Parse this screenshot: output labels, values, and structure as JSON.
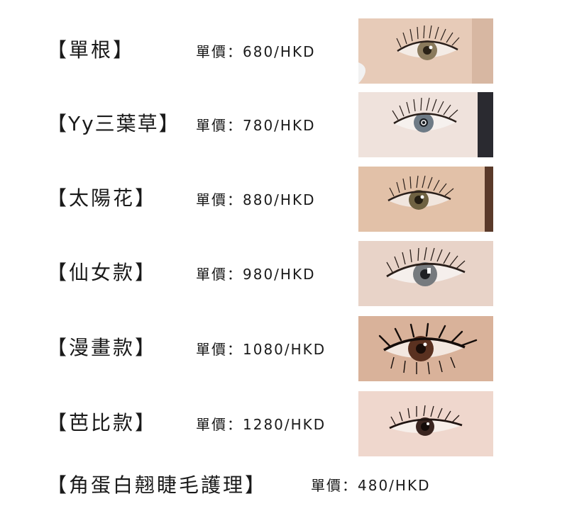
{
  "items": [
    {
      "name": "【單根】",
      "price": "單價：680/HKD",
      "photo": "eye-photo-natural-single-lash",
      "skin": "#e7cbb8",
      "iris": "#8a7a5c"
    },
    {
      "name": "【Yy三葉草】",
      "price": "單價：780/HKD",
      "photo": "eye-photo-clover-lash",
      "skin": "#efe2dc",
      "iris": "#6e7b86"
    },
    {
      "name": "【太陽花】",
      "price": "單價：880/HKD",
      "photo": "eye-photo-sunflower-lash",
      "skin": "#e2c1a8",
      "iris": "#6f6242"
    },
    {
      "name": "【仙女款】",
      "price": "單價：980/HKD",
      "photo": "eye-photo-fairy-lash",
      "skin": "#e8d3c8",
      "iris": "#767a7e"
    },
    {
      "name": "【漫畫款】",
      "price": "單價：1080/HKD",
      "photo": "eye-photo-manga-lash",
      "skin": "#d9b29a",
      "iris": "#5a3120"
    },
    {
      "name": "【芭比款】",
      "price": "單價：1280/HKD",
      "photo": "eye-photo-barbie-lash",
      "skin": "#efd7cd",
      "iris": "#3a2520"
    }
  ],
  "last_item": {
    "name": "【角蛋白翹睫毛護理】",
    "price": "單價：480/HKD"
  }
}
